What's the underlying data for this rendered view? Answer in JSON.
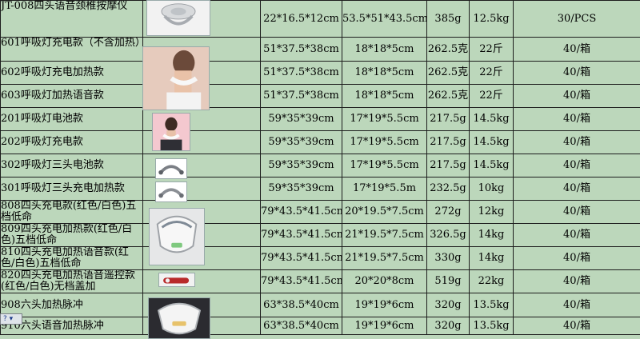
{
  "rows": [
    {
      "name": "JT-008四头语音颈椎按摩仪",
      "box": "22*16.5*12cm",
      "carton": "53.5*51*43.5cm",
      "weight": "385g",
      "gross": "12.5kg",
      "qty": "30/PCS"
    },
    {
      "name": "601呼吸灯充电款（不含加热）",
      "box": "51*37.5*38cm",
      "carton": "18*18*5cm",
      "weight": "262.5克",
      "gross": "22斤",
      "qty": "40/箱"
    },
    {
      "name": "602呼吸灯充电加热款",
      "box": "51*37.5*38cm",
      "carton": "18*18*5cm",
      "weight": "262.5克",
      "gross": "22斤",
      "qty": "40/箱"
    },
    {
      "name": "603呼吸灯加热语音款",
      "box": "51*37.5*38cm",
      "carton": "18*18*5cm",
      "weight": "262.5克",
      "gross": "22斤",
      "qty": "40/箱"
    },
    {
      "name": "201呼吸灯电池款",
      "box": "59*35*39cm",
      "carton": "17*19*5.5cm",
      "weight": "217.5g",
      "gross": "14.5kg",
      "qty": "40/箱"
    },
    {
      "name": "202呼吸灯充电款",
      "box": "59*35*39cm",
      "carton": "17*19*5.5cm",
      "weight": "217.5g",
      "gross": "14.5kg",
      "qty": "40/箱"
    },
    {
      "name": "302呼吸灯三头电池款",
      "box": "59*35*39cm",
      "carton": "17*19*5.5cm",
      "weight": "217.5g",
      "gross": "14.5kg",
      "qty": "40/箱"
    },
    {
      "name": "301呼吸灯三头充电加热款",
      "box": "59*35*39cm",
      "carton": "17*19*5.5m",
      "weight": "232.5g",
      "gross": "10kg",
      "qty": "40/箱"
    },
    {
      "name": "808四头充电款(红色/白色)五档低命",
      "box": "79*43.5*41.5cm",
      "carton": "20*19.5*7.5cm",
      "weight": "272g",
      "gross": "12kg",
      "qty": "40/箱"
    },
    {
      "name": "809四头充电加热款(红色/白色)五档低命",
      "box": "79*43.5*41.5cm",
      "carton": "21*19.5*7.5cm",
      "weight": "326.5g",
      "gross": "14kg",
      "qty": "40/箱"
    },
    {
      "name": "810四头充电加热语音款(红色/白色)五档低命",
      "box": "79*43.5*41.5cm",
      "carton": "21*19.5*7.5cm",
      "weight": "330g",
      "gross": "14kg",
      "qty": "40/箱"
    },
    {
      "name": "820四头充电加热语音遥控款(红色/白色)无档盖加",
      "box": "79*43.5*41.5cm",
      "carton": "20*20*8cm",
      "weight": "519g",
      "gross": "22kg",
      "qty": "40/箱"
    },
    {
      "name": "908六头加热脉冲",
      "box": "63*38.5*40cm",
      "carton": "19*19*6cm",
      "weight": "320g",
      "gross": "13.5kg",
      "qty": "40/箱"
    },
    {
      "name": "910六头语音加热脉冲",
      "box": "63*38.5*40cm",
      "carton": "19*19*6cm",
      "weight": "320g",
      "gross": "13.5kg",
      "qty": "40/箱"
    }
  ],
  "float_icon": "?",
  "colors": {
    "sheet_bg": "#bcd7bb",
    "grid": "#1d1d1d"
  }
}
